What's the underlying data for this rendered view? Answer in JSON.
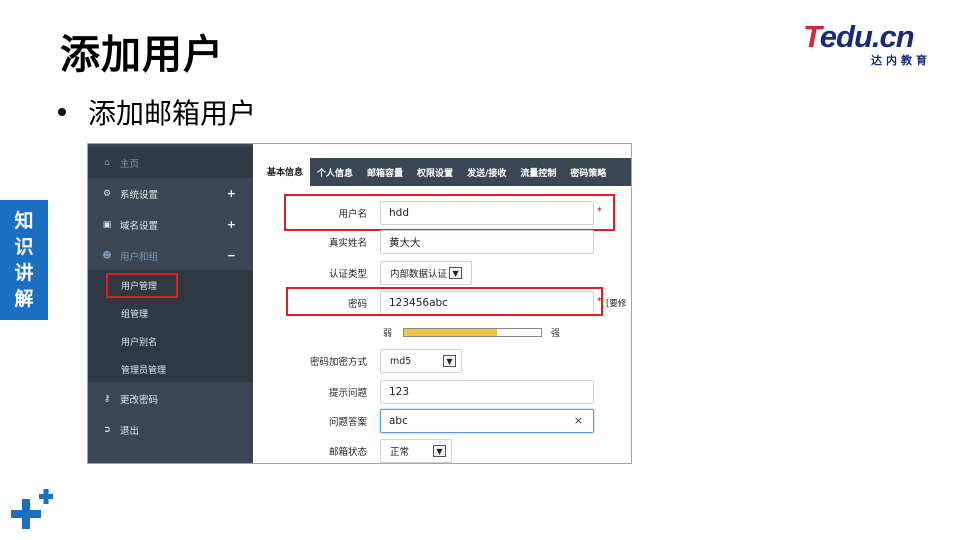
{
  "slide": {
    "title": "添加用户",
    "bullet": "添加邮箱用户",
    "side_tab_chars": [
      "知",
      "识",
      "讲",
      "解"
    ],
    "logo": {
      "main_t": "T",
      "main_rest": "edu.cn",
      "sub": "达内教育"
    }
  },
  "sidebar": {
    "home": "主页",
    "items": [
      {
        "label": "系统设置",
        "icon": "gears-icon",
        "expand": "+"
      },
      {
        "label": "域名设置",
        "icon": "monitor-icon",
        "expand": "+"
      },
      {
        "label": "用户和组",
        "icon": "users-icon",
        "expand": "−"
      }
    ],
    "sub_items": [
      "用户管理",
      "组管理",
      "用户别名",
      "管理员管理"
    ],
    "bottom_items": [
      {
        "label": "更改密码",
        "icon": "key-icon"
      },
      {
        "label": "退出",
        "icon": "logout-icon"
      }
    ]
  },
  "tabs": [
    "基本信息",
    "个人信息",
    "邮箱容量",
    "权限设置",
    "发送/接收",
    "流量控制",
    "密码策略"
  ],
  "form": {
    "username": {
      "label": "用户名",
      "value": "hdd",
      "required": "*"
    },
    "realname": {
      "label": "真实姓名",
      "value": "黄大大"
    },
    "auth_type": {
      "label": "认证类型",
      "value": "内部数据认证"
    },
    "password": {
      "label": "密码",
      "value": "123456abc",
      "required": "*",
      "note": "[要修"
    },
    "strength": {
      "weak": "弱",
      "strong": "强",
      "level": 0.68,
      "color": "#f3c342"
    },
    "encrypt": {
      "label": "密码加密方式",
      "value": "md5"
    },
    "hint_q": {
      "label": "提示问题",
      "value": "123"
    },
    "hint_a": {
      "label": "问题答案",
      "value": "abc",
      "clear": "×"
    },
    "mail_status": {
      "label": "邮箱状态",
      "value": "正常"
    }
  },
  "colors": {
    "accent_blue": "#1a6fc3",
    "sidebar_bg": "#3a4653",
    "highlight_red": "#e02020",
    "logo_red": "#d2283a",
    "logo_navy": "#1a2a7a"
  }
}
